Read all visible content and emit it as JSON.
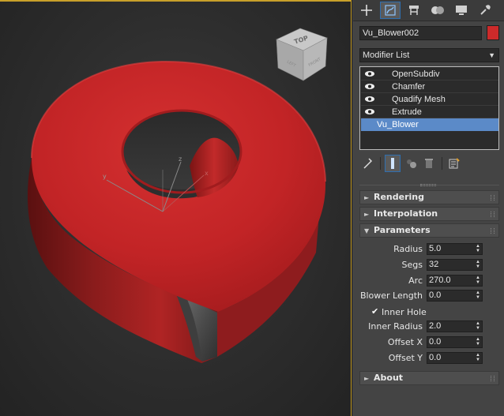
{
  "viewport": {
    "viewcube_label": "TOP",
    "viewcube_front": "FRONT",
    "viewcube_left": "LEFT",
    "gizmo_axes": [
      "x",
      "y",
      "z"
    ]
  },
  "object": {
    "name": "Vu_Blower002",
    "color": "#cc2a2a",
    "model_color": "#c42628"
  },
  "command_tabs": [
    "create-icon",
    "modify-icon",
    "hierarchy-icon",
    "motion-icon",
    "display-icon",
    "utilities-icon"
  ],
  "modifier_list": {
    "label": "Modifier List"
  },
  "stack": {
    "items": [
      {
        "label": "OpenSubdiv",
        "visible": true
      },
      {
        "label": "Chamfer",
        "visible": true
      },
      {
        "label": "Quadify Mesh",
        "visible": true
      },
      {
        "label": "Extrude",
        "visible": true
      },
      {
        "label": "Vu_Blower",
        "selected": true
      }
    ]
  },
  "rollouts": {
    "rendering": "Rendering",
    "interpolation": "Interpolation",
    "parameters": "Parameters",
    "about": "About"
  },
  "parameters": {
    "radius": {
      "label": "Radius",
      "value": "5.0"
    },
    "segs": {
      "label": "Segs",
      "value": "32"
    },
    "arc": {
      "label": "Arc",
      "value": "270.0"
    },
    "blower_length": {
      "label": "Blower Length",
      "value": "0.0"
    },
    "inner_hole": {
      "label": "Inner Hole",
      "checked": true
    },
    "inner_radius": {
      "label": "Inner Radius",
      "value": "2.0"
    },
    "offset_x": {
      "label": "Offset X",
      "value": "0.0"
    },
    "offset_y": {
      "label": "Offset Y",
      "value": "0.0"
    }
  }
}
